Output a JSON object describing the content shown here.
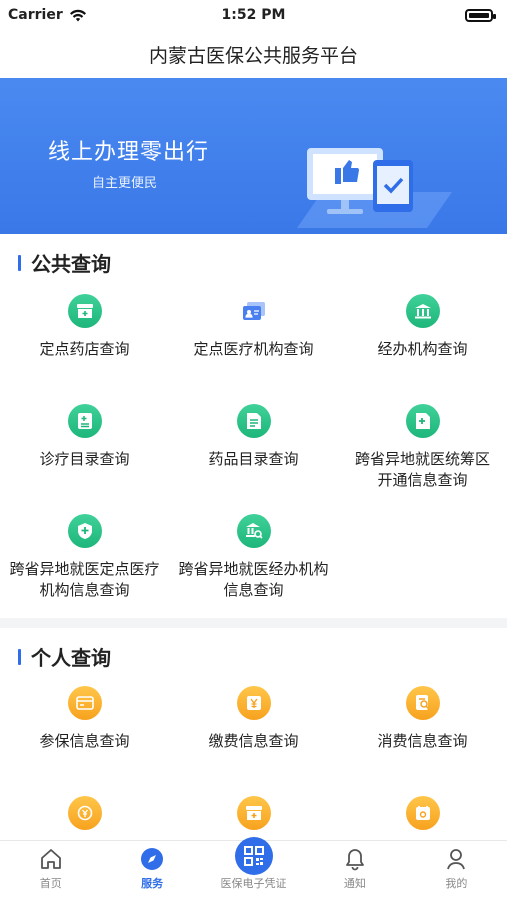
{
  "status": {
    "carrier": "Carrier",
    "time": "1:52 PM"
  },
  "header": {
    "title": "内蒙古医保公共服务平台"
  },
  "banner": {
    "title": "线上办理零出行",
    "subtitle": "自主更便民"
  },
  "public": {
    "title": "公共查询",
    "items": [
      {
        "label": "定点药店查询",
        "icon": "pharmacy-icon"
      },
      {
        "label": "定点医疗机构查询",
        "icon": "id-card-icon"
      },
      {
        "label": "经办机构查询",
        "icon": "institution-icon"
      },
      {
        "label": "诊疗目录查询",
        "icon": "catalog-icon"
      },
      {
        "label": "药品目录查询",
        "icon": "drug-list-icon"
      },
      {
        "label": "跨省异地就医统筹区开通信息查询",
        "icon": "hospital-doc-icon"
      },
      {
        "label": "跨省异地就医定点医疗机构信息查询",
        "icon": "shield-plus-icon"
      },
      {
        "label": "跨省异地就医经办机构信息查询",
        "icon": "bank-search-icon"
      }
    ]
  },
  "personal": {
    "title": "个人查询",
    "items": [
      {
        "label": "参保信息查询",
        "icon": "insurance-card-icon"
      },
      {
        "label": "缴费信息查询",
        "icon": "payment-icon"
      },
      {
        "label": "消费信息查询",
        "icon": "receipt-search-icon"
      },
      {
        "label": "",
        "icon": "coin-icon"
      },
      {
        "label": "",
        "icon": "medkit-icon"
      },
      {
        "label": "",
        "icon": "calendar-search-icon"
      }
    ]
  },
  "tabs": [
    {
      "label": "首页",
      "icon": "home-icon"
    },
    {
      "label": "服务",
      "icon": "compass-icon",
      "active": true
    },
    {
      "label": "医保电子凭证",
      "icon": "qr-code-icon"
    },
    {
      "label": "通知",
      "icon": "bell-icon"
    },
    {
      "label": "我的",
      "icon": "user-icon"
    }
  ],
  "colors": {
    "accent": "#2f6ee8",
    "green": "#1eb67a",
    "orange": "#f7a21e"
  }
}
